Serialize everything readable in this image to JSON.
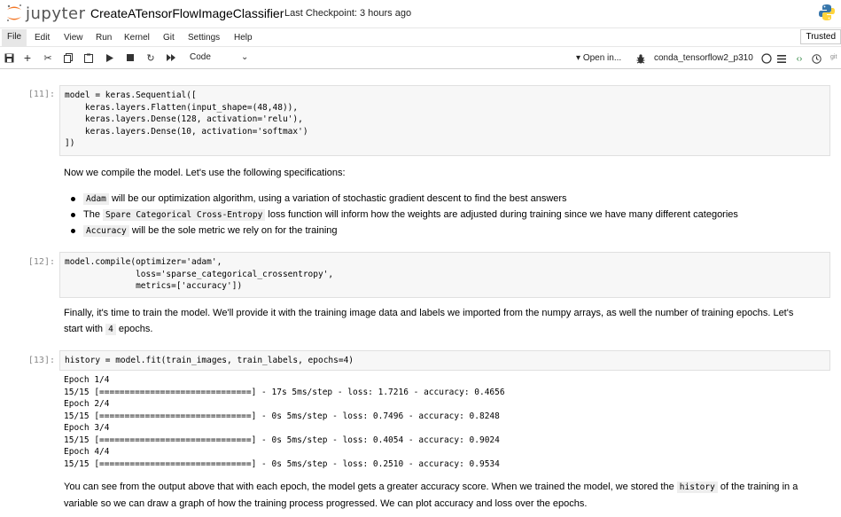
{
  "header": {
    "logo_text": "jupyter",
    "notebook_title": "CreateATensorFlowImageClassifier",
    "checkpoint": "Last Checkpoint: 3 hours ago"
  },
  "menu": {
    "items": [
      "File",
      "Edit",
      "View",
      "Run",
      "Kernel",
      "Git",
      "Settings",
      "Help"
    ],
    "trusted": "Trusted"
  },
  "toolbar": {
    "cell_type": "Code",
    "open_in": "Open in...",
    "kernel_name": "conda_tensorflow2_p310",
    "git_label": "git"
  },
  "cells": {
    "c11": {
      "prompt": "[11]:",
      "lines": [
        "model = keras.Sequential([",
        "    keras.layers.Flatten(input_shape=(48,48)),",
        "    keras.layers.Dense(128, activation='relu'),",
        "    keras.layers.Dense(10, activation='softmax')",
        "])"
      ]
    },
    "md1": {
      "text": "Now we compile the model. Let's use the following specifications:",
      "bullets": [
        {
          "code": "Adam",
          "text": " will be our optimization algorithm, using a variation of stochastic gradient descent to find the best answers",
          "prefix": ""
        },
        {
          "code": "Spare Categorical Cross-Entropy",
          "text": " loss function will inform how the weights are adjusted during training since we have many different categories",
          "prefix": "The "
        },
        {
          "code": "Accuracy",
          "text": " will be the sole metric we rely on for the training",
          "prefix": ""
        }
      ]
    },
    "c12": {
      "prompt": "[12]:",
      "lines": [
        "model.compile(optimizer='adam',",
        "              loss='sparse_categorical_crossentropy',",
        "              metrics=['accuracy'])"
      ]
    },
    "md2": {
      "text1": "Finally, it's time to train the model. We'll provide it with the training image data and labels we imported from the numpy arrays, as well the number of training epochs. Let's",
      "text2_prefix": "start with ",
      "text2_code": "4",
      "text2_suffix": " epochs."
    },
    "c13": {
      "prompt": "[13]:",
      "line": "history = model.fit(train_images, train_labels, epochs=4)",
      "output": [
        "Epoch 1/4",
        "15/15 [==============================] - 17s 5ms/step - loss: 1.7216 - accuracy: 0.4656",
        "Epoch 2/4",
        "15/15 [==============================] - 0s 5ms/step - loss: 0.7496 - accuracy: 0.8248",
        "Epoch 3/4",
        "15/15 [==============================] - 0s 5ms/step - loss: 0.4054 - accuracy: 0.9024",
        "Epoch 4/4",
        "15/15 [==============================] - 0s 5ms/step - loss: 0.2510 - accuracy: 0.9534"
      ]
    },
    "md3": {
      "text1_prefix": "You can see from the output above that with each epoch, the model gets a greater accuracy score. When we trained the model, we stored the ",
      "text1_code": "history",
      "text1_suffix": " of the training in a",
      "text2": "variable so we can draw a graph of how the training process progressed. We can plot accuracy and loss over the epochs."
    }
  },
  "colors": {
    "accent_orange": "#f37726",
    "string_red": "#ba2121",
    "number_green": "#008000"
  }
}
